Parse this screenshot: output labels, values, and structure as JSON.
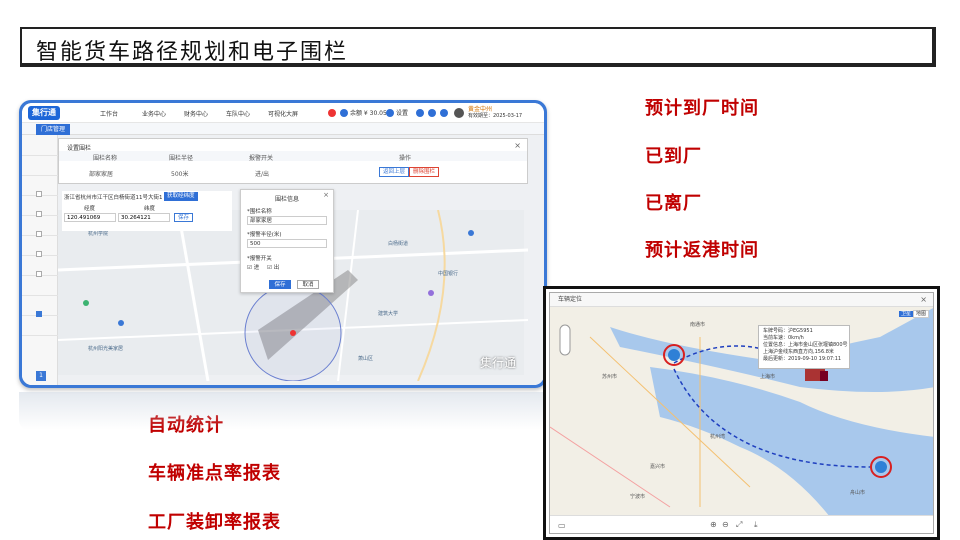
{
  "slide": {
    "title": "智能货车路径规划和电子围栏"
  },
  "features_right": [
    "预计到厂时间",
    "已到厂",
    "已离厂",
    "预计返港时间"
  ],
  "features_bottom": [
    "自动统计",
    "车辆准点率报表",
    "工厂装卸率报表"
  ],
  "app": {
    "logo": "集行通",
    "nav": [
      "工作台",
      "业务中心",
      "财务中心",
      "车队中心",
      "可视化大屏"
    ],
    "account": "余额 ¥ 30.05",
    "settings": "设置",
    "user_name": "黄金中州",
    "expire": "有效期至：2025-03-17",
    "tab": "门店管理",
    "dialog": {
      "title": "设置围栏",
      "headers": [
        "围栏名称",
        "围栏半径",
        "报警开关",
        "操作"
      ],
      "row": [
        "部家家居",
        "500米",
        "进/出"
      ],
      "btn_back": "返回上层",
      "btn_delete": "删除围栏"
    },
    "coord": {
      "address": "浙江省杭州市江干区白杨街道11号大街1",
      "btn_get": "获取经纬度",
      "lng_label": "经度",
      "lat_label": "纬度",
      "lng": "120.491069",
      "lat": "30.264121",
      "btn_save": "保存"
    },
    "fence_popup": {
      "title": "围栏信息",
      "name_label": "*围栏名称",
      "name_value": "部家家居",
      "radius_label": "*报警半径(米)",
      "radius_value": "500",
      "switch_label": "*报警开关",
      "opt_in": "进",
      "opt_out": "出",
      "save": "保存",
      "cancel": "取消"
    },
    "map_labels": [
      "白杨街道",
      "杭州学院",
      "建筑大学",
      "中国银行",
      "杭州阳光美家居",
      "萧山区"
    ],
    "watermark": "集行通",
    "page_num": "1"
  },
  "map2": {
    "title": "车辆定位",
    "toggle": [
      "卫星",
      "地图"
    ],
    "info": [
      "车牌号码：沪EG5951",
      "当前车速：0km/h",
      "位置信息：上海市金山区张堰镇800号",
      "上海沪金线东西直方向,156.8米",
      "最后更新：2019-09-10 19:07:11"
    ],
    "cities": [
      "南通市",
      "上海市",
      "苏州市",
      "嘉兴市",
      "宁波市",
      "舟山市",
      "杭州湾"
    ]
  },
  "colors": {
    "accent_red": "#c00000",
    "app_blue": "#3a78d6",
    "route_blue": "#1f3fbf"
  }
}
